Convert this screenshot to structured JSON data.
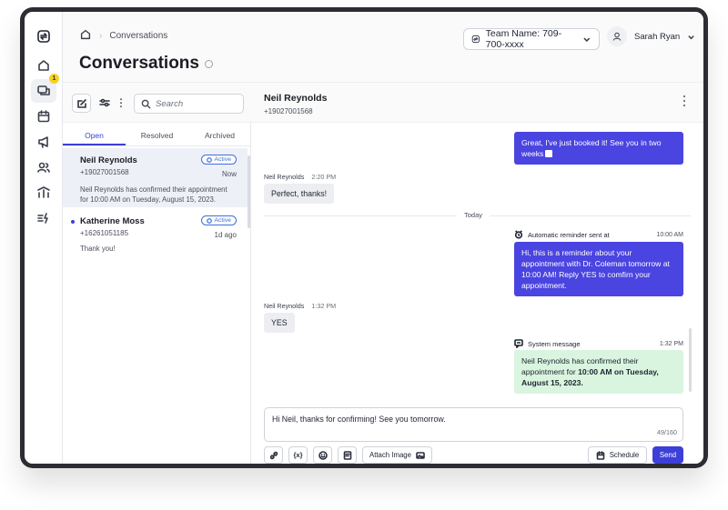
{
  "header": {
    "breadcrumb_current": "Conversations",
    "page_title": "Conversations",
    "team_select": "Team Name: 709-700-xxxx",
    "user_name": "Sarah Ryan"
  },
  "sidebar": {
    "items": [
      {
        "icon": "logo-icon"
      },
      {
        "icon": "home-icon"
      },
      {
        "icon": "chat-icon",
        "badge": "1",
        "active": true
      },
      {
        "icon": "calendar-icon"
      },
      {
        "icon": "megaphone-icon"
      },
      {
        "icon": "users-icon"
      },
      {
        "icon": "analytics-icon"
      },
      {
        "icon": "automation-icon"
      }
    ]
  },
  "list": {
    "search_placeholder": "Search",
    "tabs": [
      "Open",
      "Resolved",
      "Archived"
    ],
    "conversations": [
      {
        "name": "Neil Reynolds",
        "phone": "+19027001568",
        "status": "Active",
        "time": "Now",
        "preview": "Neil Reynolds has confirmed their appointment for 10:00 AM on Tuesday, August 15, 2023."
      },
      {
        "name": "Katherine Moss",
        "phone": "+16261051185",
        "status": "Active",
        "time": "1d ago",
        "preview": "Thank you!"
      }
    ]
  },
  "chat": {
    "contact_name": "Neil Reynolds",
    "contact_phone": "+19027001568",
    "messages": {
      "out1": "Great, I've just booked it! See you in two weeks",
      "in1_sender": "Neil Reynolds",
      "in1_time": "2:20 PM",
      "in1_text": "Perfect, thanks!",
      "divider": "Today",
      "reminder_label": "Automatic reminder sent at",
      "reminder_time": "10:00 AM",
      "reminder_text": "Hi, this is a reminder about your appointment with Dr. Coleman tomorrow at 10:00 AM! Reply YES to comfirn your appointment.",
      "in2_sender": "Neil Reynolds",
      "in2_time": "1:32 PM",
      "in2_text": "YES",
      "system_label": "System message",
      "system_time": "1:32 PM",
      "system_text_pre": "Neil Reynolds has confirmed their appointment for ",
      "system_text_bold": "10:00 AM on Tuesday, August 15, 2023."
    },
    "composer": {
      "text": "Hi Neil, thanks for confirming! See you tomorrow.",
      "count": "49/160",
      "attach_label": "Attach Image",
      "schedule_label": "Schedule",
      "send_label": "Send",
      "variable_label": "{x}"
    }
  },
  "colors": {
    "accent": "#3d3fd9",
    "outgoing_bubble": "#4a44e0",
    "system_bubble": "#d9f5df",
    "badge": "#f6d21f"
  }
}
